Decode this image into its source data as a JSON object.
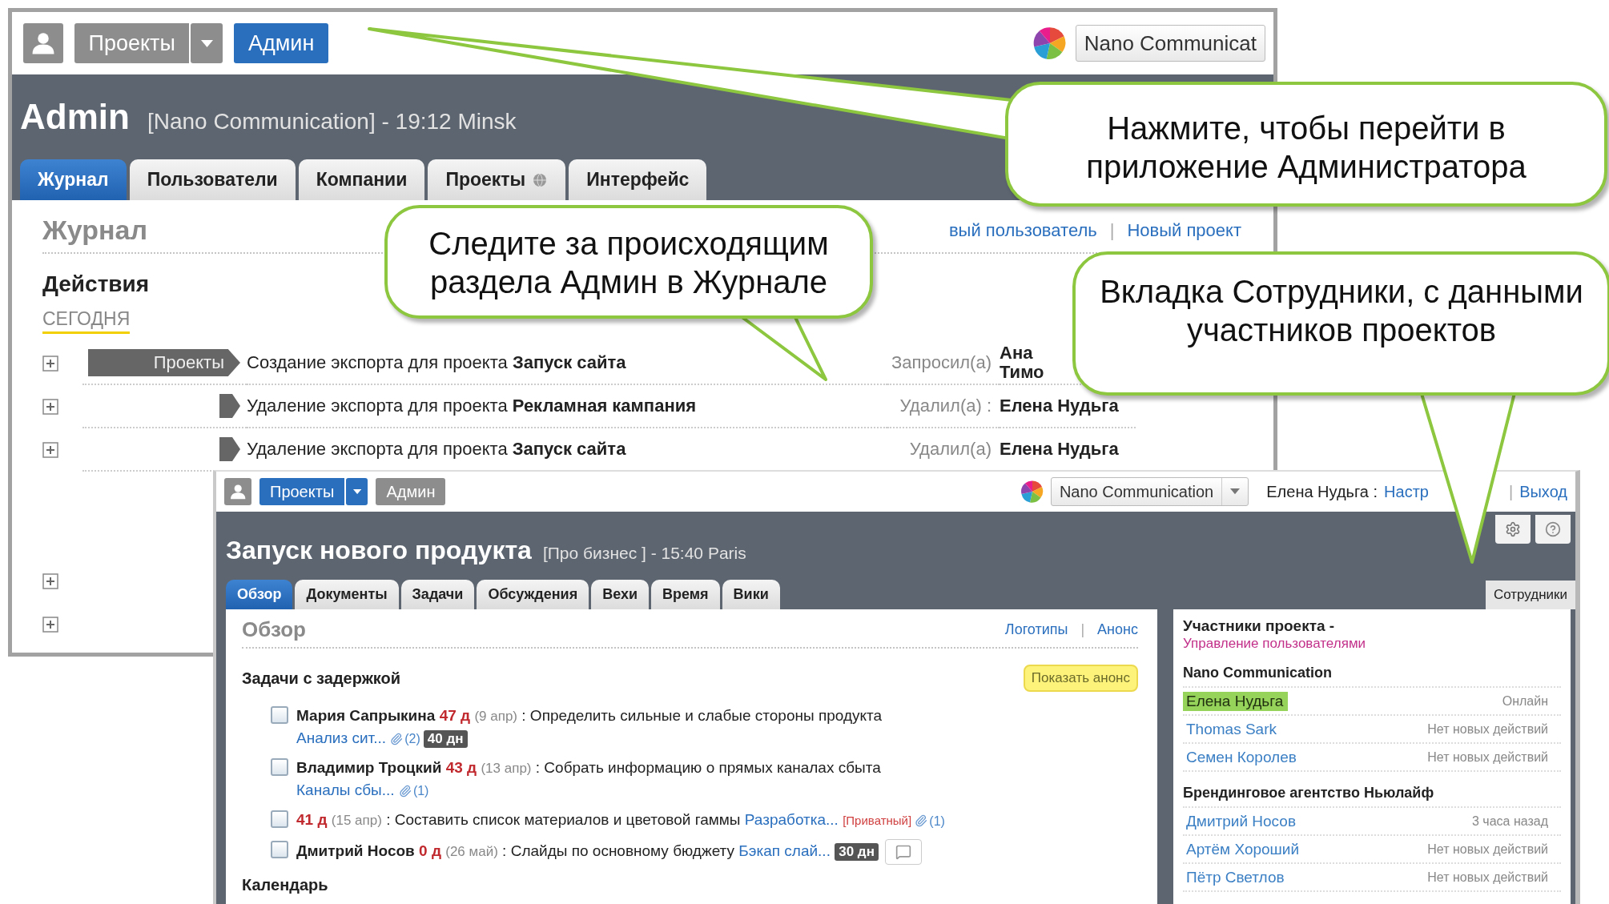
{
  "back_window": {
    "nav": [
      {
        "label": "Проекты",
        "selected": false,
        "dropdown": true
      },
      {
        "label": "Админ",
        "selected": true,
        "dropdown": false
      }
    ],
    "company": "Nano Communicat",
    "title": "Admin",
    "subtitle": "[Nano Communication] - 19:12 Minsk",
    "tabs": [
      {
        "label": "Журнал",
        "selected": true,
        "has_icon": false
      },
      {
        "label": "Пользователи",
        "selected": false,
        "has_icon": false
      },
      {
        "label": "Компании",
        "selected": false,
        "has_icon": false
      },
      {
        "label": "Проекты",
        "selected": false,
        "has_icon": true
      },
      {
        "label": "Интерфейс",
        "selected": false,
        "has_icon": false
      }
    ],
    "heading": "Журнал",
    "links": [
      "вый пользователь",
      "Новый проект"
    ],
    "links_separator": "|",
    "section": "Действия",
    "day": "СЕГОДНЯ",
    "rows": [
      {
        "expanded": false,
        "tag": "Проекты",
        "action": "Создание экспорта для проекта",
        "project": "Запуск сайта",
        "verb": "Запросил(а)",
        "person": "Ана Тимо"
      },
      {
        "expanded": false,
        "flag": true,
        "action": "Удаление экспорта для проекта",
        "project": "Рекламная кампания",
        "verb": "Удалил(а) :",
        "person": "Елена Нудьга"
      },
      {
        "expanded": false,
        "flag": true,
        "action": "Удаление экспорта для проекта",
        "project": "Запуск сайта",
        "verb": "Удалил(а)",
        "person": "Елена Нудьга"
      },
      {
        "expanded": false
      },
      {
        "expanded": false
      }
    ]
  },
  "front_window": {
    "nav": [
      {
        "label": "Проекты",
        "selected": true,
        "dropdown": true
      },
      {
        "label": "Админ",
        "selected": false,
        "dropdown": false
      }
    ],
    "company": "Nano Communication",
    "user": "Елена Нудьга",
    "user_separator": ":",
    "user_links": [
      "Настр",
      "Выход"
    ],
    "user_links_separator": "|",
    "title": "Запуск нового продукта",
    "subtitle": "[Про бизнес ] - 15:40 Paris",
    "tabs": [
      {
        "label": "Обзор",
        "selected": true
      },
      {
        "label": "Документы",
        "selected": false
      },
      {
        "label": "Задачи",
        "selected": false
      },
      {
        "label": "Обсуждения",
        "selected": false
      },
      {
        "label": "Вехи",
        "selected": false
      },
      {
        "label": "Время",
        "selected": false
      },
      {
        "label": "Вики",
        "selected": false
      }
    ],
    "side_tab": {
      "label": "Сотрудники",
      "selected": true
    },
    "heading": "Обзор",
    "links": [
      "Логотипы",
      "Анонс"
    ],
    "links_separator": "|",
    "late_title": "Задачи с задержкой",
    "announce_button": "Показать анонс",
    "tasks": [
      {
        "checked": false,
        "person": "Мария Сапрыкина",
        "late": "47 д",
        "date": "(9 апр)",
        "text": ": Определить сильные и слабые стороны продукта",
        "link": "Анализ сит...",
        "attachments": "(2)",
        "badge": "40 дн",
        "comment": false
      },
      {
        "checked": false,
        "person": "Владимир Троцкий",
        "late": "43 д",
        "date": "(13 апр)",
        "text": ": Собрать информацию о прямых каналах сбыта",
        "link": "Каналы сбы...",
        "attachments": "(1)",
        "comment": false
      },
      {
        "checked": false,
        "late": "41 д",
        "date": "(15 апр)",
        "text": ": Составить список материалов и цветовой гаммы",
        "link": "Разработка...",
        "private": "[Приватный]",
        "attachments": "(1)",
        "comment": false
      },
      {
        "checked": false,
        "person": "Дмитрий Носов",
        "late": "0 д",
        "date": "(26 май)",
        "text": ": Слайды по основному бюджету",
        "link": "Бэкап слай...",
        "badge": "30 дн",
        "comment": true
      }
    ],
    "calendar_title": "Календарь",
    "members_title": "Участники проекта",
    "members_separator": "-",
    "manage_link": "Управление пользователями",
    "groups": [
      {
        "name": "Nano Communication",
        "members": [
          {
            "name": "Елена Нудьга",
            "status": "Онлайн",
            "online": true
          },
          {
            "name": "Thomas Sark",
            "status": "Нет новых действий",
            "online": false
          },
          {
            "name": "Семен Королев",
            "status": "Нет новых действий",
            "online": false
          }
        ]
      },
      {
        "name": "Брендинговое агентство Ньюлайф",
        "members": [
          {
            "name": "Дмитрий Носов",
            "status": "3 часа назад",
            "online": false
          },
          {
            "name": "Артём Хороший",
            "status": "Нет новых действий",
            "online": false
          },
          {
            "name": "Пётр Светлов",
            "status": "Нет новых действий",
            "online": false
          }
        ]
      }
    ]
  },
  "callouts": [
    {
      "text": "Нажмите, чтобы перейти в приложение Администратора"
    },
    {
      "text": "Следите за происходящим раздела Админ в Журнале"
    },
    {
      "text": "Вкладка Сотрудники, с данными участников проектов"
    }
  ]
}
